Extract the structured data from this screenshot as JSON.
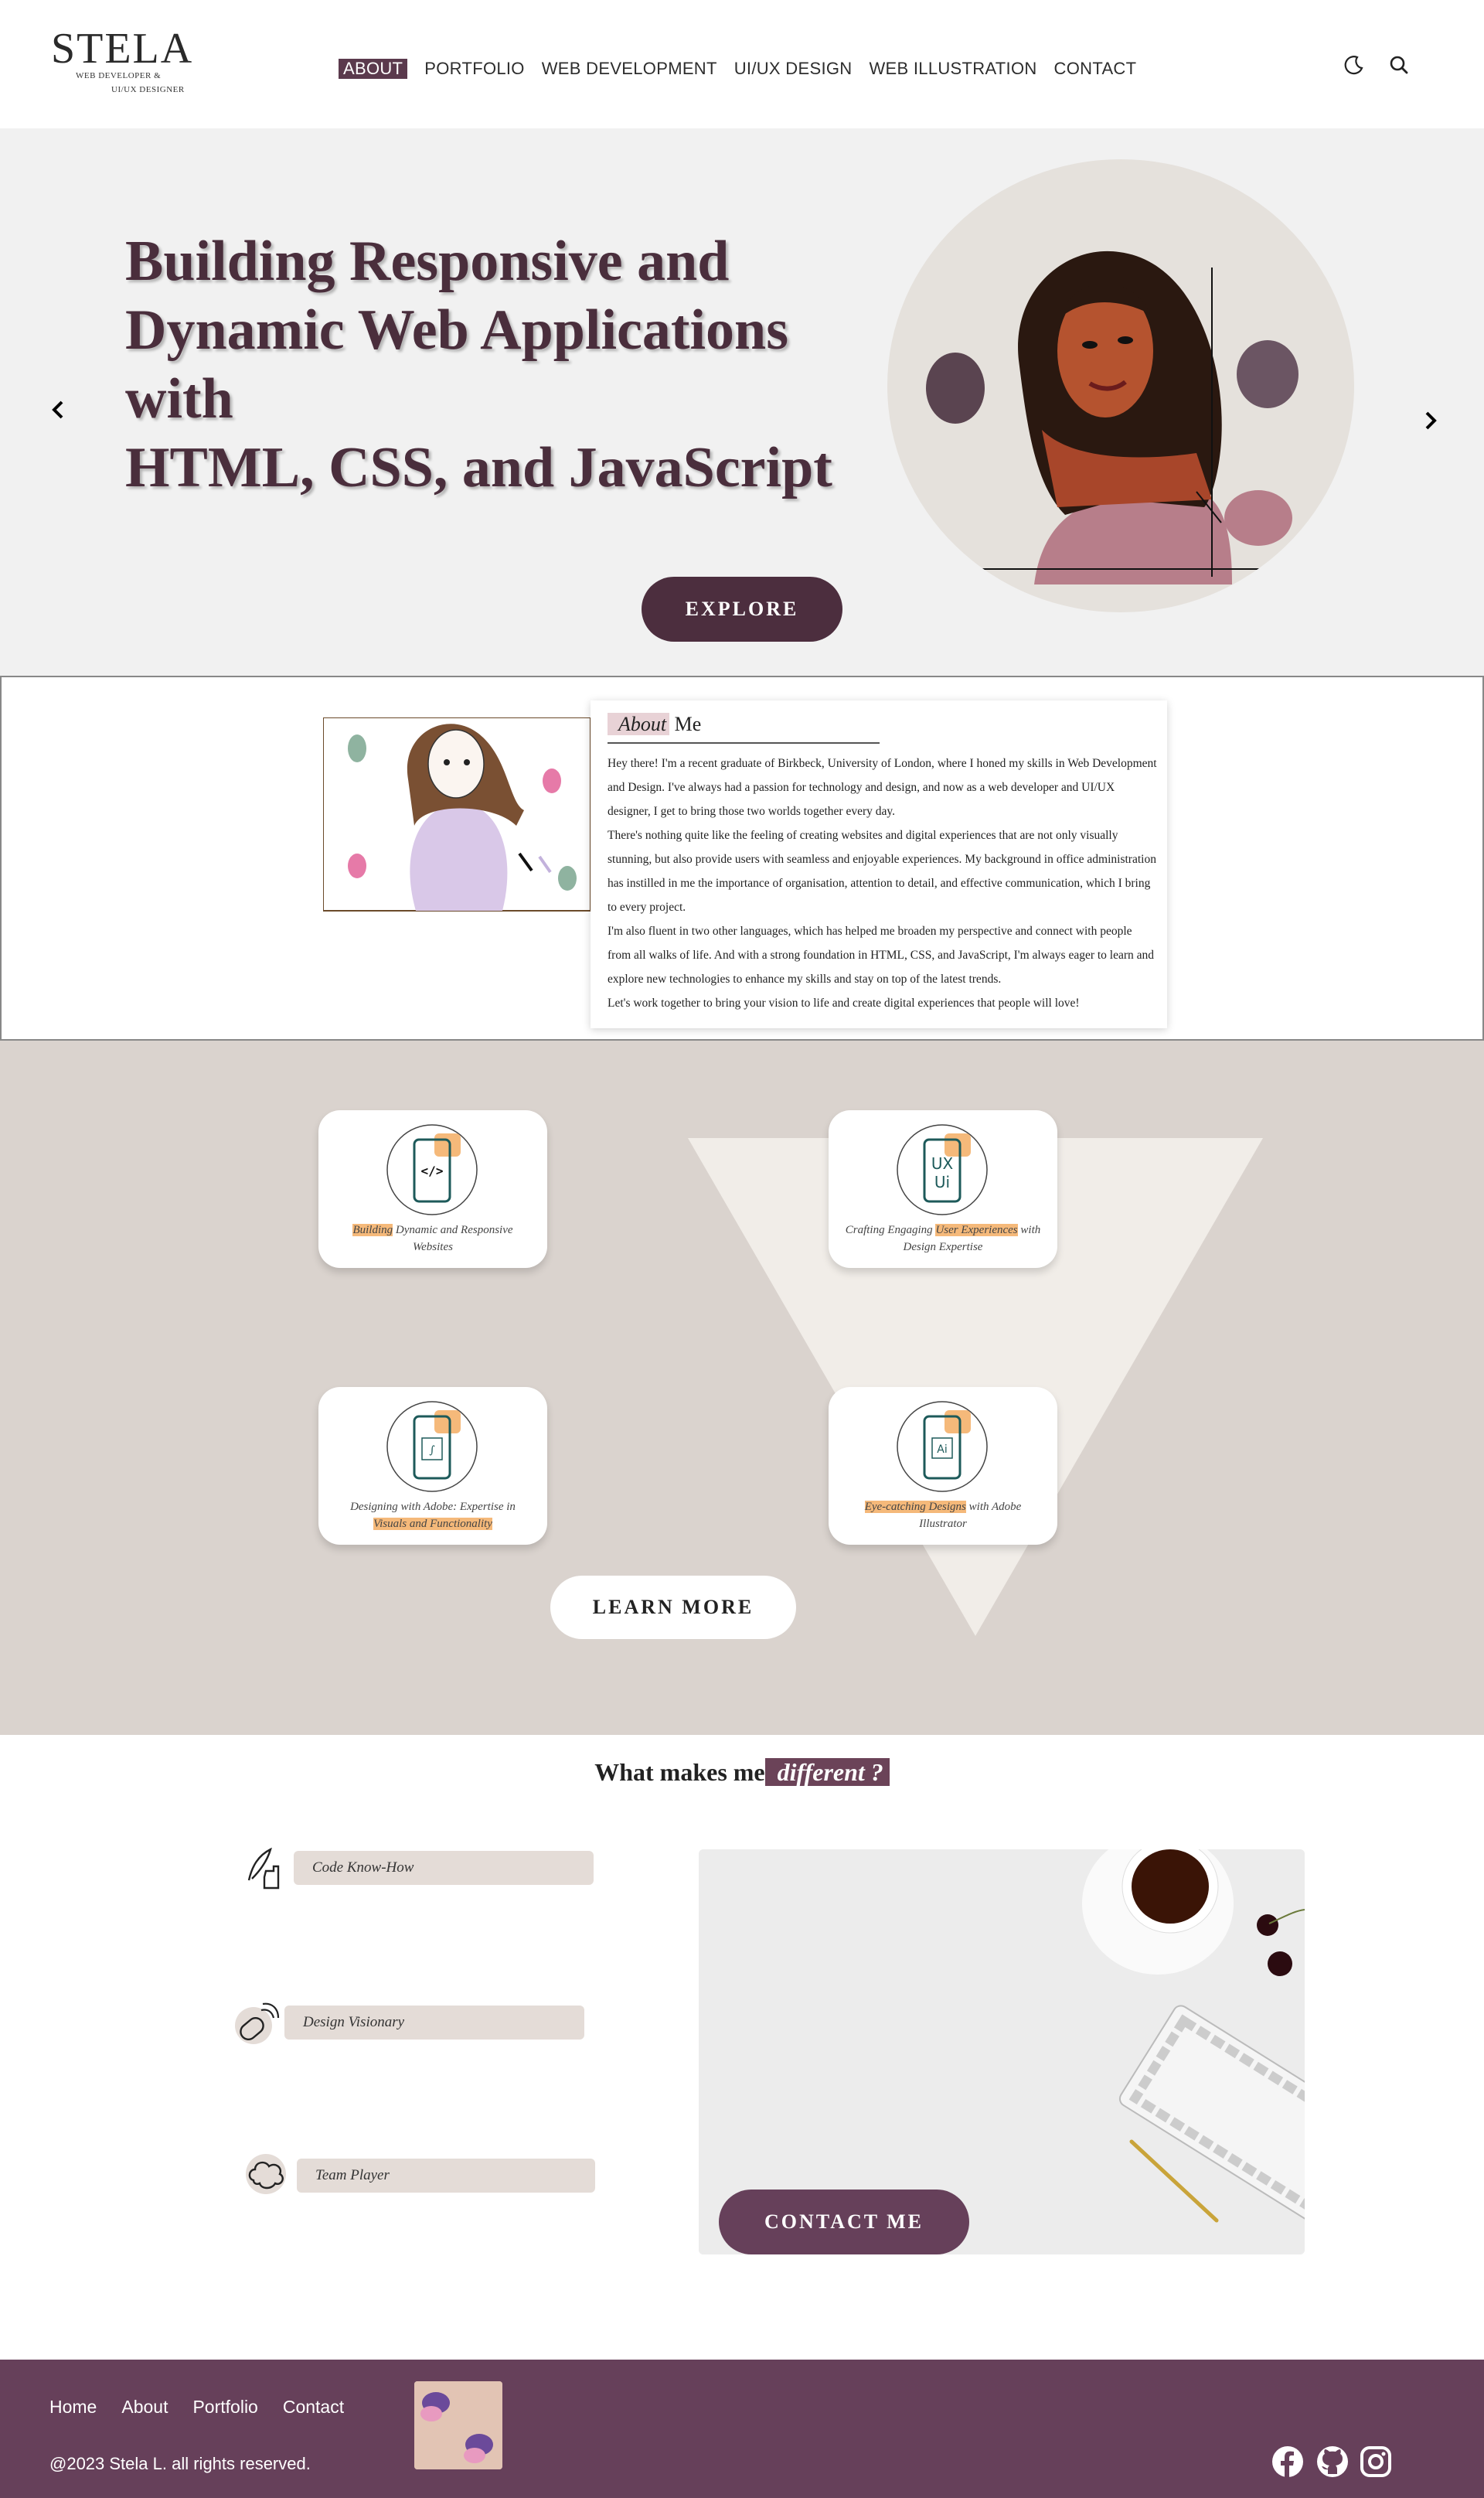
{
  "header": {
    "logo_name": "STELA",
    "logo_sub1": "WEB DEVELOPER &",
    "logo_sub2": "UI/UX DESIGNER",
    "nav": [
      "ABOUT",
      "PORTFOLIO",
      "WEB DEVELOPMENT",
      "UI/UX DESIGN",
      "WEB ILLUSTRATION",
      "CONTACT"
    ],
    "active_nav": "ABOUT",
    "icons": [
      "moon-icon",
      "search-icon"
    ]
  },
  "hero": {
    "title_lines": [
      "Building Responsive and",
      "Dynamic Web Applications with",
      "HTML, CSS, and JavaScript"
    ],
    "explore_label": "EXPLORE"
  },
  "about": {
    "heading_hl": "About",
    "heading_rest": " Me",
    "paragraphs": [
      "Hey there! I'm a recent graduate of Birkbeck, University of London, where I honed my skills in Web Development and Design. I've always had a passion for technology and design, and now as a web developer and UI/UX designer, I get to bring those two worlds together every day.",
      "There's nothing quite like the feeling of creating websites and digital experiences that are not only visually stunning, but also provide users with seamless and enjoyable experiences. My background in office administration has instilled in me the importance of organisation, attention to detail, and effective communication, which I bring to every project.",
      "I'm also fluent in two other languages, which has helped me broaden my perspective and connect with people from all walks of life. And with a strong foundation in HTML, CSS, and JavaScript, I'm always eager to learn and explore new technologies to enhance my skills and stay on top of the latest trends.",
      "Let's work together to bring your vision to life and create digital experiences that people will love!"
    ]
  },
  "services": {
    "cards": [
      {
        "hl": "Building",
        "rest": " Dynamic and Responsive Websites",
        "icon": "code-phone-icon",
        "glyph": "</>"
      },
      {
        "pre": "Crafting Engaging ",
        "hl": "User Experiences",
        "rest": " with Design Expertise",
        "icon": "uxui-phone-icon",
        "glyph": "UX"
      },
      {
        "pre": "Designing with Adobe: Expertise in ",
        "hl": "Visuals and Functionality",
        "icon": "photoshop-phone-icon",
        "glyph": "∫"
      },
      {
        "hl": "Eye-catching Designs",
        "rest": " with Adobe Illustrator",
        "icon": "illustrator-phone-icon",
        "glyph": "Ai"
      }
    ],
    "learn_label": "LEARN MORE"
  },
  "different": {
    "title_pre": "What makes me",
    "title_hl": " different ?",
    "traits": [
      "Code Know-How",
      "Design Visionary",
      "Team Player"
    ],
    "contact_label": "CONTACT ME"
  },
  "footer": {
    "links": [
      "Home",
      "About",
      "Portfolio",
      "Contact"
    ],
    "copyright": "@2023 Stela L. all rights reserved.",
    "social": [
      "facebook-icon",
      "github-icon",
      "instagram-icon"
    ]
  },
  "colors": {
    "plum": "#4c2e3e",
    "footer": "#66405a",
    "taupe": "#dad3ce",
    "highlight": "#f5b97a"
  }
}
